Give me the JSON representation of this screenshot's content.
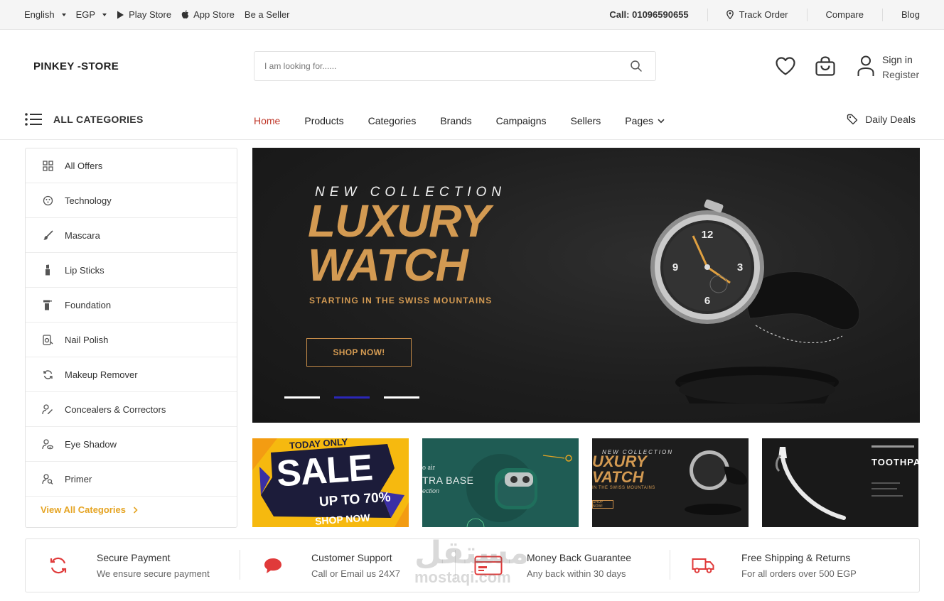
{
  "topbar": {
    "language": "English",
    "currency": "EGP",
    "play_store": "Play Store",
    "app_store": "App Store",
    "be_seller": "Be a Seller",
    "call": "Call: 01096590655",
    "track_order": "Track Order",
    "compare": "Compare",
    "blog": "Blog"
  },
  "header": {
    "logo": "PINKEY -STORE",
    "search_placeholder": "I am looking for......",
    "sign_in": "Sign in",
    "register": "Register"
  },
  "nav": {
    "all_categories": "ALL CATEGORIES",
    "items": [
      {
        "label": "Home",
        "active": true
      },
      {
        "label": "Products"
      },
      {
        "label": "Categories"
      },
      {
        "label": "Brands"
      },
      {
        "label": "Campaigns"
      },
      {
        "label": "Sellers"
      },
      {
        "label": "Pages"
      }
    ],
    "daily_deals": "Daily Deals"
  },
  "sidebar": {
    "items": [
      {
        "label": "All Offers",
        "icon": "grid-icon"
      },
      {
        "label": "Technology",
        "icon": "chip-icon"
      },
      {
        "label": "Mascara",
        "icon": "brush-icon"
      },
      {
        "label": "Lip Sticks",
        "icon": "lipstick-icon"
      },
      {
        "label": "Foundation",
        "icon": "spray-icon"
      },
      {
        "label": "Nail Polish",
        "icon": "nail-polish-icon"
      },
      {
        "label": "Makeup Remover",
        "icon": "refresh-icon"
      },
      {
        "label": "Concealers & Correctors",
        "icon": "user-edit-icon"
      },
      {
        "label": "Eye Shadow",
        "icon": "user-eye-icon"
      },
      {
        "label": "Primer",
        "icon": "user-search-icon"
      }
    ],
    "view_all": "View All Categories"
  },
  "hero": {
    "kicker": "NEW COLLECTION",
    "line1": "LUXURY",
    "line2": "WATCH",
    "subtitle": "STARTING IN THE SWISS MOUNTAINS",
    "cta": "SHOP NOW!",
    "active_slide": 1,
    "slide_count": 3
  },
  "tiles": {
    "sale": {
      "top": "TODAY ONLY",
      "main": "SALE",
      "pct": "UP TO 70%",
      "shop": "SHOP NOW"
    },
    "airpods": {
      "top": "o air",
      "main": "TRA BASE",
      "sub": "ection"
    },
    "watch": {
      "top": "NEW COLLECTION",
      "l1": "UXURY",
      "l2": "VATCH",
      "sub": "IN THE SWISS MOUNTAINS",
      "btn": "SHOP NOW!"
    },
    "toothpaste": {
      "title": "TOOTHPA"
    }
  },
  "features": [
    {
      "title": "Secure Payment",
      "sub": "We ensure secure payment",
      "icon": "refresh-icon"
    },
    {
      "title": "Customer Support",
      "sub": "Call or Email us 24X7",
      "icon": "chat-icon"
    },
    {
      "title": "Money Back Guarantee",
      "sub": "Any back within 30 days",
      "icon": "credit-card-icon"
    },
    {
      "title": "Free Shipping & Returns",
      "sub": "For all orders over 500 EGP",
      "icon": "truck-icon"
    }
  ],
  "watermark": {
    "arabic": "مستقل",
    "latin": "mostaqi.com"
  },
  "colors": {
    "accent": "#c0392b",
    "gold": "#d39a52",
    "view_all": "#e5a423",
    "slide_active": "#2b27b8",
    "feature_icon": "#e03a3a"
  }
}
